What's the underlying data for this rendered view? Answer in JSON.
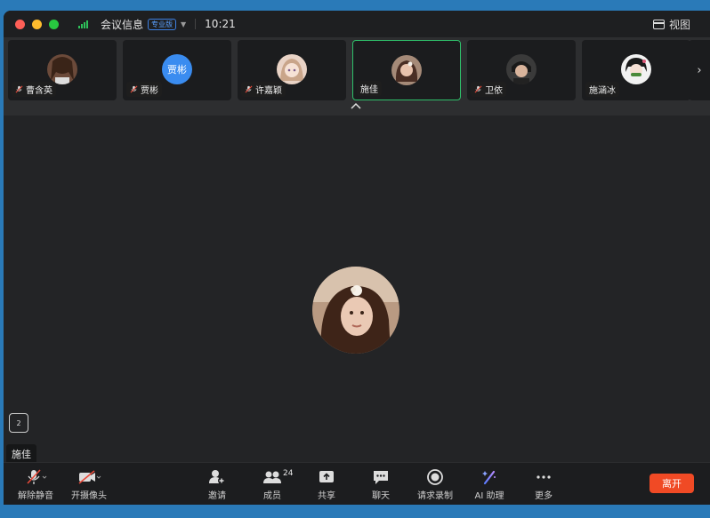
{
  "titlebar": {
    "title": "会议信息",
    "badge": "专业版",
    "time": "10:21",
    "view_label": "视图"
  },
  "participants": [
    {
      "name": "曹含英",
      "muted": true
    },
    {
      "name": "贾彬",
      "muted": true,
      "initials": "贾彬"
    },
    {
      "name": "许嘉颖",
      "muted": true
    },
    {
      "name": "施佳",
      "muted": false,
      "active": true
    },
    {
      "name": "卫依",
      "muted": true
    },
    {
      "name": "施涵冰",
      "muted": false
    }
  ],
  "speaker": {
    "name": "施佳"
  },
  "chip_label": "2",
  "toolbar": {
    "unmute": "解除静音",
    "camera": "开摄像头",
    "invite": "邀请",
    "members": "成员",
    "members_count": "24",
    "share": "共享",
    "chat": "聊天",
    "record": "请求录制",
    "ai": "AI 助理",
    "more": "更多",
    "leave": "离开"
  },
  "colors": {
    "accent_green": "#2fc06a",
    "leave_red": "#f04a25",
    "avatar_blue": "#3a8cf0"
  }
}
